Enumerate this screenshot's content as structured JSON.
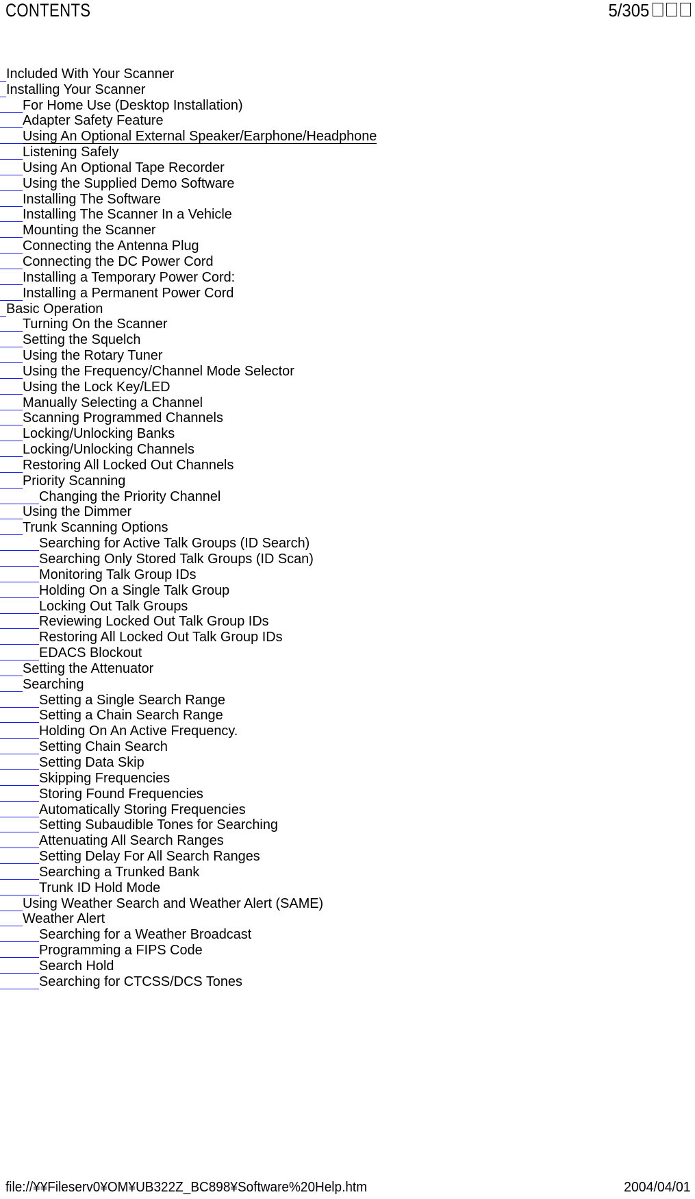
{
  "header": {
    "title": "CONTENTS",
    "page_indicator": "5/305",
    "page_unit_glyphs": [
      "missing-glyph-box",
      "missing-glyph-box",
      "missing-glyph-box"
    ]
  },
  "colors": {
    "link_indent_rule": "#1a1ae6",
    "text": "#000000",
    "background": "#ffffff"
  },
  "toc": {
    "items": [
      {
        "level": 1,
        "label": "Included With Your Scanner",
        "active": false
      },
      {
        "level": 1,
        "label": "Installing Your Scanner",
        "active": false
      },
      {
        "level": 2,
        "label": "For Home Use (Desktop Installation)",
        "active": false
      },
      {
        "level": 2,
        "label": "Adapter Safety Feature",
        "active": false
      },
      {
        "level": 2,
        "label": "Using An Optional External Speaker/Earphone/Headphone",
        "active": true
      },
      {
        "level": 2,
        "label": "Listening Safely",
        "active": false
      },
      {
        "level": 2,
        "label": "Using An Optional Tape Recorder",
        "active": false
      },
      {
        "level": 2,
        "label": "Using the Supplied Demo Software",
        "active": false
      },
      {
        "level": 2,
        "label": "Installing The Software",
        "active": false
      },
      {
        "level": 2,
        "label": "Installing The Scanner In a Vehicle",
        "active": false
      },
      {
        "level": 2,
        "label": "Mounting the Scanner",
        "active": false
      },
      {
        "level": 2,
        "label": "Connecting the Antenna Plug",
        "active": false
      },
      {
        "level": 2,
        "label": "Connecting the DC Power Cord",
        "active": false
      },
      {
        "level": 2,
        "label": "Installing a Temporary Power Cord:",
        "active": false
      },
      {
        "level": 2,
        "label": "Installing a Permanent Power Cord",
        "active": false
      },
      {
        "level": 1,
        "label": "Basic Operation",
        "active": false
      },
      {
        "level": 2,
        "label": "Turning On the Scanner",
        "active": false
      },
      {
        "level": 2,
        "label": "Setting the Squelch",
        "active": false
      },
      {
        "level": 2,
        "label": "Using the Rotary Tuner",
        "active": false
      },
      {
        "level": 2,
        "label": "Using the Frequency/Channel Mode Selector",
        "active": false
      },
      {
        "level": 2,
        "label": "Using the Lock Key/LED",
        "active": false
      },
      {
        "level": 2,
        "label": "Manually Selecting a Channel",
        "active": false
      },
      {
        "level": 2,
        "label": "Scanning Programmed Channels",
        "active": false
      },
      {
        "level": 2,
        "label": "Locking/Unlocking Banks",
        "active": false
      },
      {
        "level": 2,
        "label": "Locking/Unlocking Channels",
        "active": false
      },
      {
        "level": 2,
        "label": "Restoring All Locked Out Channels",
        "active": false
      },
      {
        "level": 2,
        "label": "Priority Scanning",
        "active": false
      },
      {
        "level": 3,
        "label": "Changing the Priority Channel",
        "active": false
      },
      {
        "level": 2,
        "label": "Using the Dimmer",
        "active": false
      },
      {
        "level": 2,
        "label": "Trunk Scanning Options",
        "active": false
      },
      {
        "level": 3,
        "label": "Searching for Active Talk Groups (ID Search)",
        "active": false
      },
      {
        "level": 3,
        "label": "Searching Only Stored Talk Groups (ID Scan)",
        "active": false
      },
      {
        "level": 3,
        "label": "Monitoring Talk Group IDs",
        "active": false
      },
      {
        "level": 3,
        "label": "Holding On a Single Talk Group",
        "active": false
      },
      {
        "level": 3,
        "label": "Locking Out Talk Groups",
        "active": false
      },
      {
        "level": 3,
        "label": "Reviewing Locked Out Talk Group IDs",
        "active": false
      },
      {
        "level": 3,
        "label": "Restoring All Locked Out Talk Group IDs",
        "active": false
      },
      {
        "level": 3,
        "label": "EDACS Blockout",
        "active": false
      },
      {
        "level": 2,
        "label": "Setting the Attenuator",
        "active": false
      },
      {
        "level": 2,
        "label": "Searching",
        "active": false
      },
      {
        "level": 3,
        "label": "Setting a Single Search Range",
        "active": false
      },
      {
        "level": 3,
        "label": "Setting a Chain Search Range",
        "active": false
      },
      {
        "level": 3,
        "label": "Holding On An Active Frequency.",
        "active": false
      },
      {
        "level": 3,
        "label": "Setting Chain Search",
        "active": false
      },
      {
        "level": 3,
        "label": "Setting Data Skip",
        "active": false
      },
      {
        "level": 3,
        "label": "Skipping Frequencies",
        "active": false
      },
      {
        "level": 3,
        "label": "Storing Found Frequencies",
        "active": false
      },
      {
        "level": 3,
        "label": "Automatically Storing Frequencies",
        "active": false
      },
      {
        "level": 3,
        "label": "Setting Subaudible Tones for Searching",
        "active": false
      },
      {
        "level": 3,
        "label": "Attenuating All Search Ranges",
        "active": false
      },
      {
        "level": 3,
        "label": "Setting Delay For All Search Ranges",
        "active": false
      },
      {
        "level": 3,
        "label": "Searching a Trunked Bank",
        "active": false
      },
      {
        "level": 3,
        "label": "Trunk ID Hold Mode",
        "active": false
      },
      {
        "level": 2,
        "label": "Using Weather Search and Weather Alert (SAME)",
        "active": false
      },
      {
        "level": 2,
        "label": "Weather Alert",
        "active": false
      },
      {
        "level": 3,
        "label": "Searching for a Weather Broadcast",
        "active": false
      },
      {
        "level": 3,
        "label": "Programming a FIPS Code",
        "active": false
      },
      {
        "level": 3,
        "label": "Search Hold",
        "active": false
      },
      {
        "level": 3,
        "label": "Searching for CTCSS/DCS Tones",
        "active": false
      }
    ]
  },
  "footer": {
    "path": "file://¥¥Fileserv0¥OM¥UB322Z_BC898¥Software%20Help.htm",
    "date": "2004/04/01"
  }
}
